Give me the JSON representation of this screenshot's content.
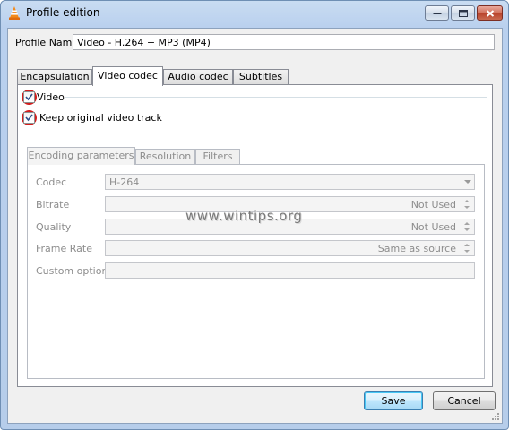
{
  "window": {
    "title": "Profile edition"
  },
  "profile": {
    "label": "Profile Name",
    "value": "Video - H.264 + MP3 (MP4)"
  },
  "tabs": [
    {
      "label": "Encapsulation",
      "active": false
    },
    {
      "label": "Video codec",
      "active": true
    },
    {
      "label": "Audio codec",
      "active": false
    },
    {
      "label": "Subtitles",
      "active": false
    }
  ],
  "video_codec": {
    "video_checkbox": {
      "label": "Video",
      "checked": true
    },
    "keep_original": {
      "label": "Keep original video track",
      "checked": true
    },
    "subtabs": [
      {
        "label": "Encoding parameters",
        "active": true
      },
      {
        "label": "Resolution",
        "active": false
      },
      {
        "label": "Filters",
        "active": false
      }
    ],
    "fields": {
      "codec": {
        "label": "Codec",
        "value": "H-264"
      },
      "bitrate": {
        "label": "Bitrate",
        "value": "Not Used"
      },
      "quality": {
        "label": "Quality",
        "value": "Not Used"
      },
      "frame_rate": {
        "label": "Frame Rate",
        "value": "Same as source"
      },
      "custom_options": {
        "label": "Custom options",
        "value": ""
      }
    }
  },
  "buttons": {
    "save": "Save",
    "cancel": "Cancel"
  },
  "watermark": "www.wintips.org",
  "colors": {
    "highlight_ring": "#d21d1d",
    "titlebar": "#b9d0ee",
    "close_button": "#c0533d"
  }
}
